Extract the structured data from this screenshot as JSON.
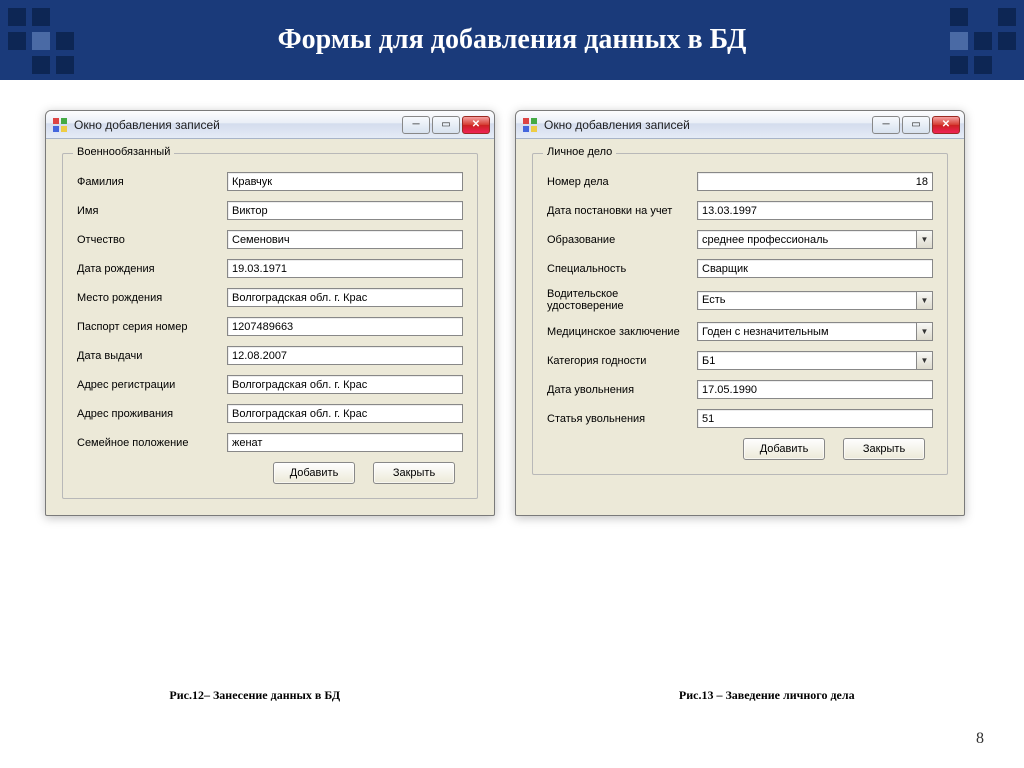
{
  "slide": {
    "title": "Формы для добавления данных в БД",
    "page_number": "8",
    "caption_left": "Рис.12– Занесение  данных в БД",
    "caption_right": "Рис.13 – Заведение личного дела"
  },
  "window_left": {
    "title": "Окно добавления записей",
    "group_legend": "Военнообязанный",
    "fields": [
      {
        "label": "Фамилия",
        "value": "Кравчук",
        "type": "text"
      },
      {
        "label": "Имя",
        "value": "Виктор",
        "type": "text"
      },
      {
        "label": "Отчество",
        "value": "Семенович",
        "type": "text"
      },
      {
        "label": "Дата рождения",
        "value": "19.03.1971",
        "type": "text"
      },
      {
        "label": "Место рождения",
        "value": "Волгоградская обл. г. Крас",
        "type": "text"
      },
      {
        "label": "Паспорт серия номер",
        "value": "1207489663",
        "type": "text"
      },
      {
        "label": "Дата выдачи",
        "value": "12.08.2007",
        "type": "text"
      },
      {
        "label": "Адрес регистрации",
        "value": "Волгоградская обл. г. Крас",
        "type": "text"
      },
      {
        "label": "Адрес проживания",
        "value": "Волгоградская обл. г. Крас",
        "type": "text"
      },
      {
        "label": "Семейное положение",
        "value": "женат",
        "type": "text"
      }
    ],
    "buttons": {
      "add": "Добавить",
      "close": "Закрыть"
    }
  },
  "window_right": {
    "title": "Окно добавления записей",
    "group_legend": "Личное дело",
    "fields": [
      {
        "label": "Номер дела",
        "value": "18",
        "type": "text",
        "align": "right"
      },
      {
        "label": "Дата постановки на учет",
        "value": "13.03.1997",
        "type": "text"
      },
      {
        "label": "Образование",
        "value": "среднее профессиональ",
        "type": "combo"
      },
      {
        "label": "Специальность",
        "value": "Сварщик",
        "type": "text"
      },
      {
        "label": "Водительское удостоверение",
        "value": "Есть",
        "type": "combo"
      },
      {
        "label": "Медицинское заключение",
        "value": "Годен с незначительным",
        "type": "combo"
      },
      {
        "label": "Категория годности",
        "value": "Б1",
        "type": "combo"
      },
      {
        "label": "Дата увольнения",
        "value": "17.05.1990",
        "type": "text"
      },
      {
        "label": "Статья увольнения",
        "value": "51",
        "type": "text"
      }
    ],
    "buttons": {
      "add": "Добавить",
      "close": "Закрыть"
    }
  }
}
